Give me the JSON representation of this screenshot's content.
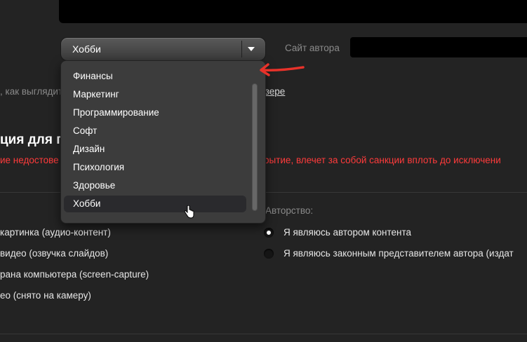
{
  "form": {
    "site_label": "Сайт автора",
    "preview_hint": ", как выглядит",
    "browser_link": "узере",
    "section_title": "ция для п",
    "warning_left": "ие недостове",
    "warning_right": "рытие, влечет за собой санкции вплоть до исключени"
  },
  "category_select": {
    "value": "Хобби",
    "options": [
      "Финансы",
      "Маркетинг",
      "Программирование",
      "Софт",
      "Дизайн",
      "Психология",
      "Здоровье",
      "Хобби"
    ],
    "selected_index": 7
  },
  "format_options": [
    "картинка (аудио-контент)",
    "видео (озвучка слайдов)",
    "рана компьютера (screen-capture)",
    "ео (снято на камеру)"
  ],
  "authorship": {
    "title": "Авторство:",
    "options": [
      {
        "label": "Я являюсь автором контента",
        "checked": true
      },
      {
        "label": "Я являюсь законным представителем автора (издат",
        "checked": false
      }
    ]
  },
  "colors": {
    "background": "#232323",
    "warning": "#ff3b3b",
    "annotation_arrow": "#e8322a"
  }
}
